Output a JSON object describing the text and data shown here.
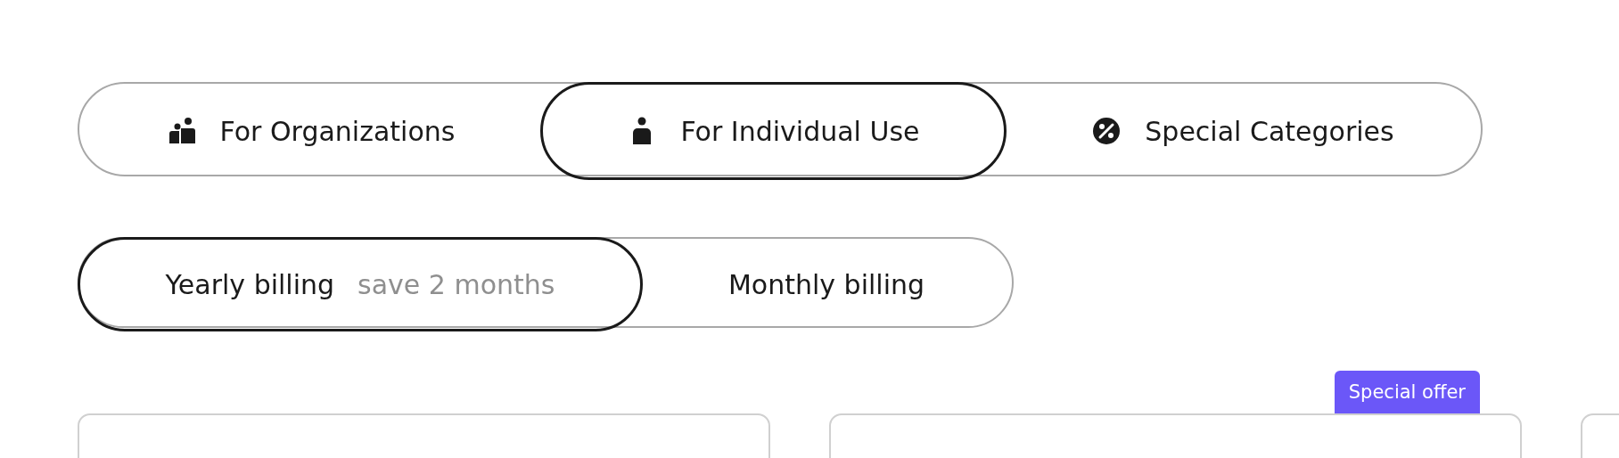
{
  "audience_tabs": [
    {
      "label": "For Organizations",
      "kind": "group",
      "selected": false
    },
    {
      "label": "For Individual Use",
      "kind": "person",
      "selected": true
    },
    {
      "label": "Special Categories",
      "kind": "percent",
      "selected": false
    }
  ],
  "billing_options": [
    {
      "label": "Yearly billing",
      "note": "save 2 months",
      "selected": true
    },
    {
      "label": "Monthly billing",
      "selected": false
    }
  ],
  "plan_cards": [
    {
      "kind": "plain"
    },
    {
      "kind": "offer",
      "badge": "Special offer"
    },
    {
      "kind": "plain"
    }
  ]
}
